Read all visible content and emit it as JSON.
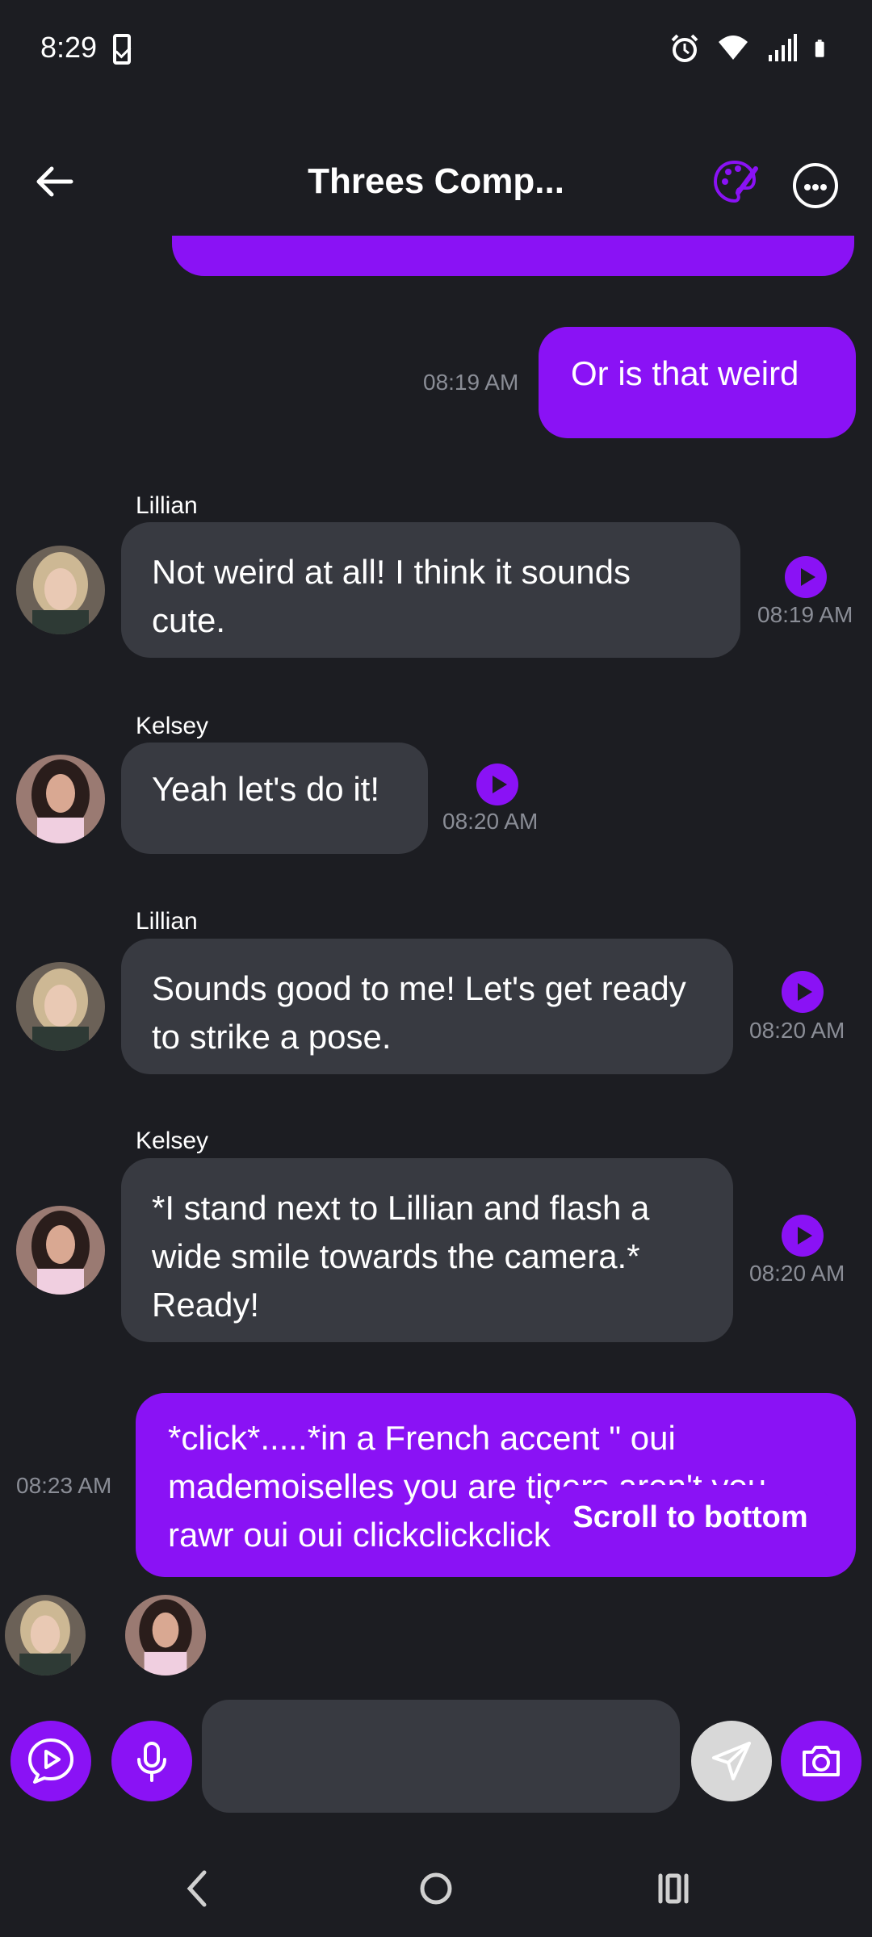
{
  "status_bar": {
    "time": "8:29"
  },
  "header": {
    "title": "Threes Comp..."
  },
  "messages": [
    {
      "sender": "",
      "text": "Or is that weird",
      "time": "08:19 AM"
    },
    {
      "sender": "Lillian",
      "text": "Not weird at all! I think it sounds cute.",
      "time": "08:19 AM"
    },
    {
      "sender": "Kelsey",
      "text": "Yeah let's do it!",
      "time": "08:20 AM"
    },
    {
      "sender": "Lillian",
      "text": "Sounds good to me! Let's get ready to strike a pose.",
      "time": "08:20 AM"
    },
    {
      "sender": "Kelsey",
      "text": "*I stand next to Lillian and flash a wide smile towards the camera.* Ready!",
      "time": "08:20 AM"
    },
    {
      "sender": "",
      "text": "*click*.....*in a French accent \" oui mademoiselles you are tigers aren't you rawr oui oui clickclickclick",
      "time": "08:23 AM"
    }
  ],
  "scroll_to_bottom": "Scroll to bottom",
  "input": {
    "placeholder": ""
  },
  "colors": {
    "accent": "#8a12f5",
    "background": "#1c1d22",
    "bubble_in": "#383a41"
  }
}
